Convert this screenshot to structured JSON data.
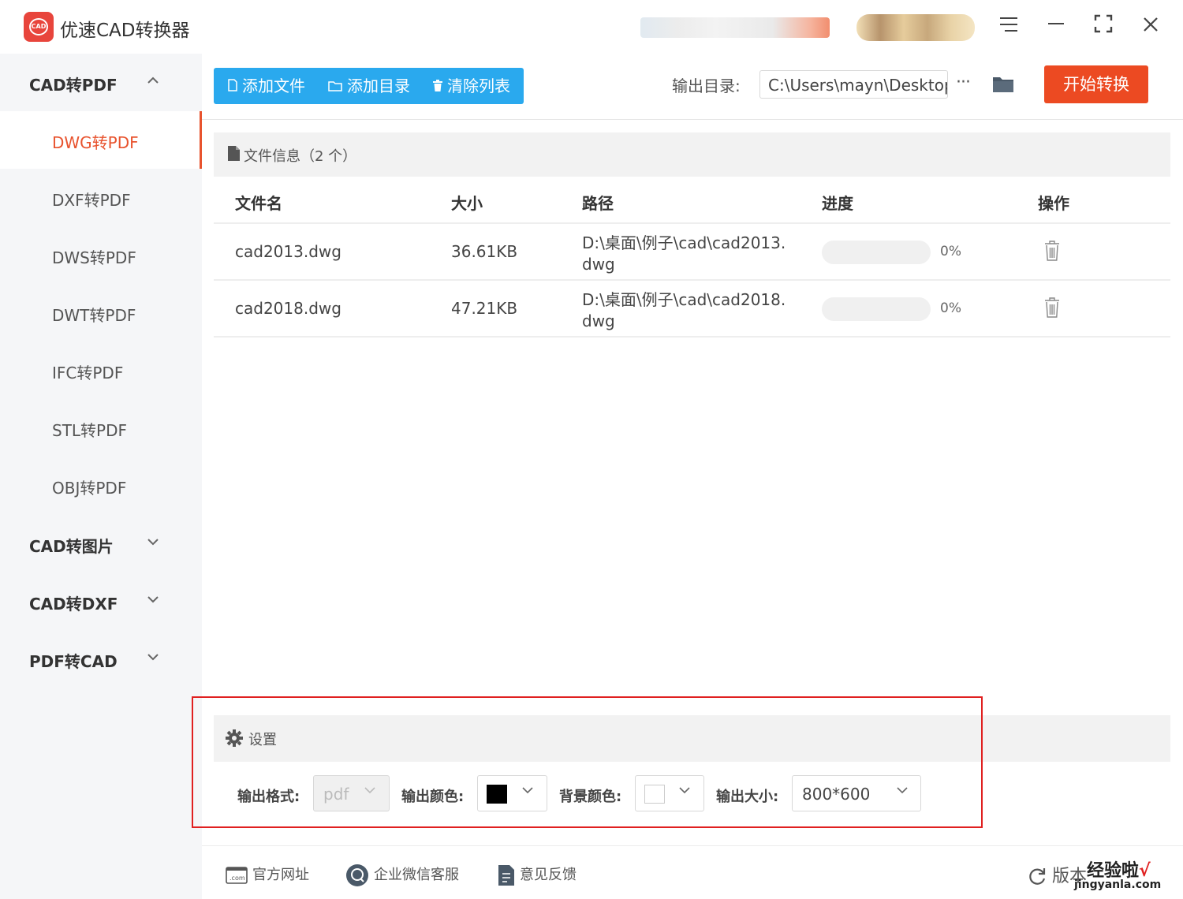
{
  "app": {
    "title": "优速CAD转换器",
    "logo_text": "CAD",
    "window_controls": [
      "menu-icon",
      "minimize-icon",
      "fullscreen-icon",
      "close-icon"
    ]
  },
  "sidebar": {
    "groups": [
      {
        "label": "CAD转PDF",
        "expanded": true,
        "items": [
          {
            "label": "DWG转PDF",
            "active": true
          },
          {
            "label": "DXF转PDF"
          },
          {
            "label": "DWS转PDF"
          },
          {
            "label": "DWT转PDF"
          },
          {
            "label": "IFC转PDF"
          },
          {
            "label": "STL转PDF"
          },
          {
            "label": "OBJ转PDF"
          }
        ]
      },
      {
        "label": "CAD转图片",
        "expanded": false
      },
      {
        "label": "CAD转DXF",
        "expanded": false
      },
      {
        "label": "PDF转CAD",
        "expanded": false
      }
    ]
  },
  "toolbar": {
    "add_file": "添加文件",
    "add_dir": "添加目录",
    "clear_list": "清除列表",
    "output_label": "输出目录:",
    "output_path": "C:\\Users\\mayn\\Desktop",
    "more": "···",
    "start": "开始转换"
  },
  "file_panel": {
    "title": "文件信息（2 个）",
    "columns": [
      "文件名",
      "大小",
      "路径",
      "进度",
      "操作"
    ],
    "rows": [
      {
        "name": "cad2013.dwg",
        "size": "36.61KB",
        "path_line1": "D:\\桌面\\例子\\cad\\cad2013.",
        "path_line2": "dwg",
        "progress": 0,
        "progress_text": "0%"
      },
      {
        "name": "cad2018.dwg",
        "size": "47.21KB",
        "path_line1": "D:\\桌面\\例子\\cad\\cad2018.",
        "path_line2": "dwg",
        "progress": 0,
        "progress_text": "0%"
      }
    ]
  },
  "settings": {
    "title": "设置",
    "format_label": "输出格式:",
    "format_value": "pdf",
    "color_label": "输出颜色:",
    "color_value": "#000000",
    "bg_label": "背景颜色:",
    "bg_value": "#ffffff",
    "size_label": "输出大小:",
    "size_value": "800*600"
  },
  "footer": {
    "website": "官方网址",
    "wechat": "企业微信客服",
    "feedback": "意见反馈",
    "version": "版本"
  },
  "watermark": {
    "text": "经验啦",
    "check": "√",
    "url": "jingyanla.com"
  },
  "colors": {
    "accent_blue": "#2aa9ee",
    "accent_orange": "#ec4a22",
    "active_text": "#e8532e",
    "highlight_box": "#e02020"
  }
}
